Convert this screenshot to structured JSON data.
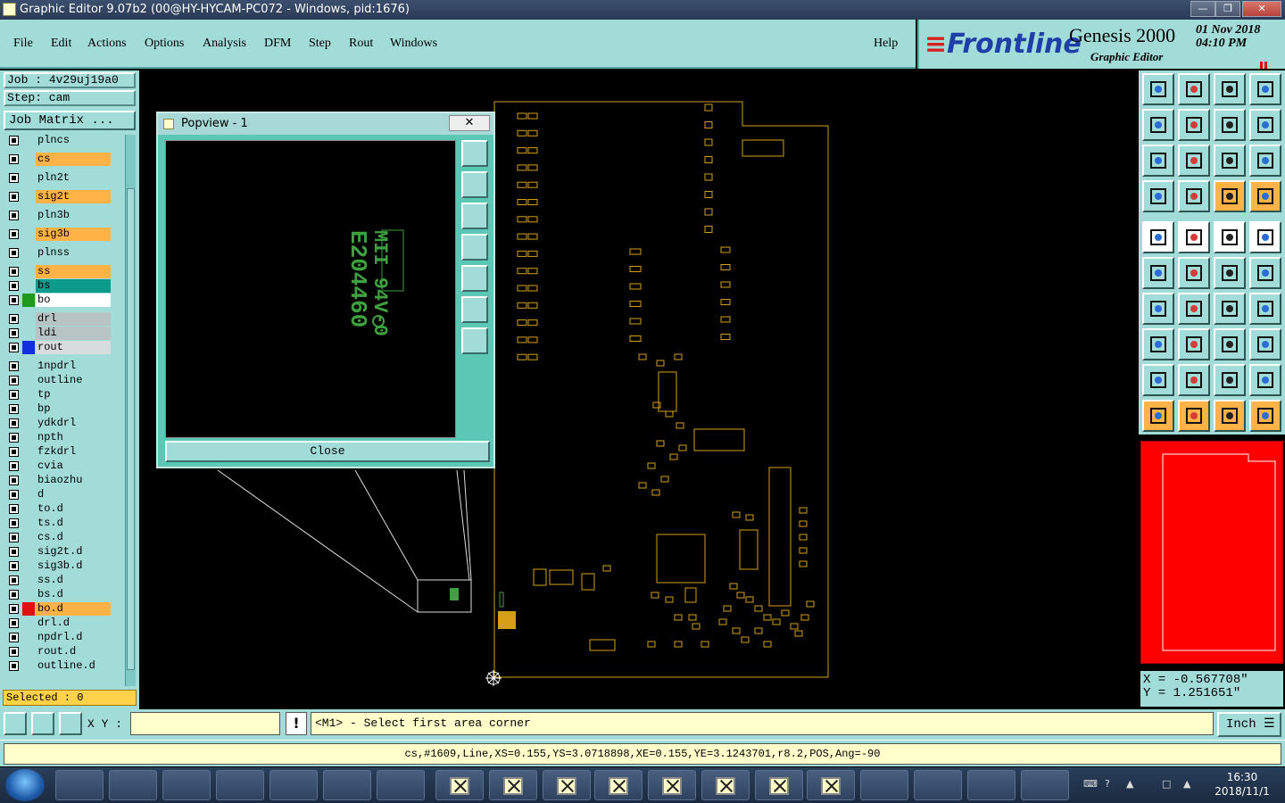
{
  "window": {
    "title": "Graphic Editor 9.07b2 (00@HY-HYCAM-PC072 - Windows, pid:1676)",
    "min_label": "—",
    "max_label": "❐",
    "close_label": "✕"
  },
  "menu": {
    "items": [
      "File",
      "Edit",
      "Actions",
      "Options",
      "Analysis",
      "DFM",
      "Step",
      "Rout",
      "Windows"
    ],
    "help": "Help"
  },
  "logo": {
    "brand": "Frontline",
    "product": "Genesis 2000",
    "subtitle": "Graphic Editor",
    "date": "01 Nov 2018",
    "time": "04:10 PM"
  },
  "left": {
    "job": "Job : 4v29uj19a0",
    "step": "Step: cam",
    "job_matrix": "Job Matrix ...",
    "selected": "Selected : 0",
    "layers": [
      {
        "name": "plncs",
        "bg": "#a2dcd9",
        "swatch": ""
      },
      {
        "name": "cs",
        "bg": "#ffb347",
        "swatch": ""
      },
      {
        "name": "pln2t",
        "bg": "#a2dcd9",
        "swatch": ""
      },
      {
        "name": "sig2t",
        "bg": "#ffb347",
        "swatch": ""
      },
      {
        "name": "pln3b",
        "bg": "#a2dcd9",
        "swatch": ""
      },
      {
        "name": "sig3b",
        "bg": "#ffb347",
        "swatch": ""
      },
      {
        "name": "plnss",
        "bg": "#a2dcd9",
        "swatch": ""
      },
      {
        "name": "ss",
        "bg": "#ffb347",
        "swatch": ""
      },
      {
        "name": "bs",
        "bg": "#0e9a8a",
        "swatch": ""
      },
      {
        "name": "bo",
        "bg": "#ffffff",
        "swatch": "#1f9a1f"
      },
      {
        "name": "drl",
        "bg": "#b8c4c4",
        "swatch": ""
      },
      {
        "name": "ldi",
        "bg": "#b8c4c4",
        "swatch": ""
      },
      {
        "name": "rout",
        "bg": "#d8dcdc",
        "swatch": "#1030e0"
      },
      {
        "name": "1npdrl",
        "bg": "#a2dcd9",
        "swatch": ""
      },
      {
        "name": "outline",
        "bg": "#a2dcd9",
        "swatch": ""
      },
      {
        "name": "tp",
        "bg": "#a2dcd9",
        "swatch": ""
      },
      {
        "name": "bp",
        "bg": "#a2dcd9",
        "swatch": ""
      },
      {
        "name": "ydkdrl",
        "bg": "#a2dcd9",
        "swatch": ""
      },
      {
        "name": "npth",
        "bg": "#a2dcd9",
        "swatch": ""
      },
      {
        "name": "fzkdrl",
        "bg": "#a2dcd9",
        "swatch": ""
      },
      {
        "name": "cvia",
        "bg": "#a2dcd9",
        "swatch": ""
      },
      {
        "name": "biaozhu",
        "bg": "#a2dcd9",
        "swatch": ""
      },
      {
        "name": "d",
        "bg": "#a2dcd9",
        "swatch": ""
      },
      {
        "name": "to.d",
        "bg": "#a2dcd9",
        "swatch": ""
      },
      {
        "name": "ts.d",
        "bg": "#a2dcd9",
        "swatch": ""
      },
      {
        "name": "cs.d",
        "bg": "#a2dcd9",
        "swatch": ""
      },
      {
        "name": "sig2t.d",
        "bg": "#a2dcd9",
        "swatch": ""
      },
      {
        "name": "sig3b.d",
        "bg": "#a2dcd9",
        "swatch": ""
      },
      {
        "name": "ss.d",
        "bg": "#a2dcd9",
        "swatch": ""
      },
      {
        "name": "bs.d",
        "bg": "#a2dcd9",
        "swatch": ""
      },
      {
        "name": "bo.d",
        "bg": "#ffb347",
        "swatch": "#e01010"
      },
      {
        "name": "drl.d",
        "bg": "#a2dcd9",
        "swatch": ""
      },
      {
        "name": "npdrl.d",
        "bg": "#a2dcd9",
        "swatch": ""
      },
      {
        "name": "rout.d",
        "bg": "#a2dcd9",
        "swatch": ""
      },
      {
        "name": "outline.d",
        "bg": "#a2dcd9",
        "swatch": ""
      }
    ]
  },
  "popview": {
    "title": "Popview - 1",
    "close_x": "✕",
    "close_button": "Close",
    "silk_line1": "E204460",
    "silk_line2": "MII 94V-0"
  },
  "coords": {
    "x": "X  = -0.567708\"",
    "y": "Y  = 1.251651\""
  },
  "bottom": {
    "xy_label": "X Y :",
    "xy_value": "",
    "excl": "!",
    "prompt": "<M1> - Select first area corner",
    "unit": "Inch",
    "status": "cs,#1609,Line,XS=0.155,YS=3.0718898,XE=0.155,YE=3.1243701,r8.2,POS,Ang=-90"
  },
  "taskbar": {
    "time": "16:30",
    "date": "2018/11/1"
  },
  "colors": {
    "panel": "#a2dcd9",
    "board_outline": "#d4a017",
    "highlight": "#ffb347"
  }
}
